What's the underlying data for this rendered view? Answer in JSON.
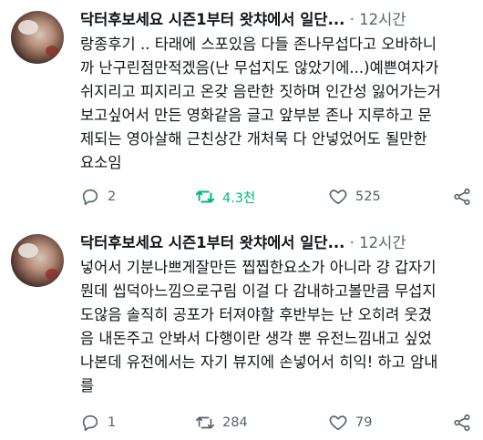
{
  "tweets": [
    {
      "author": "닥터후보세요 시즌1부터 왓챠에서 일단...",
      "separator": "·",
      "time": "12시간",
      "text": "랑종후기 .. 타래에 스포있음 다들 존나무섭다고 오바하니\n까 난구린점만적겠음(난 무섭지도 않았기에...)예쁜여자가\n쉬지리고 피지리고 온갖 음란한 짓하며 인간성 잃어가는거\n보고싶어서 만든 영화같음 글고 앞부분 존나 지루하고 문\n제되는 영아살해 근친상간 개처묵 다 안넣었어도 될만한\n요소임",
      "actions": {
        "replies": "2",
        "retweets": "4.3천",
        "likes": "525"
      },
      "retweeted": true,
      "icons": {
        "reply": "reply-icon",
        "retweet": "retweet-icon",
        "like": "heart-icon",
        "share": "share-icon"
      }
    },
    {
      "author": "닥터후보세요 시즌1부터 왓챠에서 일단...",
      "separator": "·",
      "time": "12시간",
      "text": "넣어서 기분나쁘게잘만든 찝찝한요소가 아니라 걍 갑자기\n뭔데 씹덕아느낌으로구림 이걸 다 감내하고볼만큼 무섭지\n도않음 솔직히 공포가 터져야할 후반부는 난 오히려 웃겼\n음 내돈주고 안봐서 다행이란 생각 뿐   유전느낌내고 싶었\n나본데 유전에서는 자기 뷰지에 손넣어서 히익! 하고 암내\n를",
      "actions": {
        "replies": "1",
        "retweets": "284",
        "likes": "79"
      },
      "retweeted": false,
      "icons": {
        "reply": "reply-icon",
        "retweet": "retweet-icon",
        "like": "heart-icon",
        "share": "share-icon"
      }
    }
  ],
  "colors": {
    "text": "#0f1419",
    "secondary": "#536471",
    "retweet_active": "#00ba7c"
  }
}
